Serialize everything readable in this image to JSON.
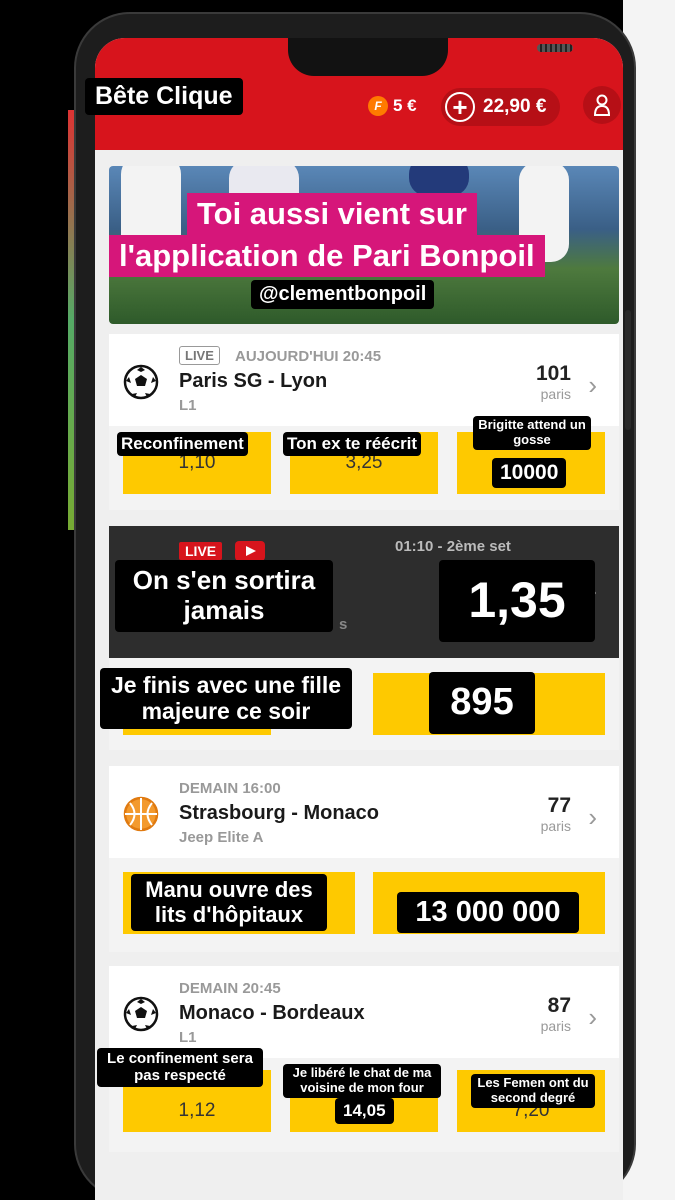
{
  "app": {
    "brand": "Bête Clique",
    "freebet_label": "F",
    "freebet_amount": "5 €",
    "balance": "22,90 €"
  },
  "banner": {
    "line1": "Toi aussi vient sur",
    "line2": "l'application de Pari Bonpoil",
    "handle": "@clementbonpoil"
  },
  "matches": [
    {
      "live_tag": "LIVE",
      "when": "AUJOURD'HUI 20:45",
      "teams": "Paris SG - Lyon",
      "league": "L1",
      "bets_count": "101",
      "bets_label": "paris",
      "odds": [
        {
          "label": "Reconfinement",
          "value": "1,10"
        },
        {
          "label": "Ton ex te réécrit",
          "value": "3,25"
        },
        {
          "label": "Brigitte attend un gosse",
          "value": "10000"
        }
      ]
    },
    {
      "live_tag": "LIVE",
      "when": "01:10 - 2ème set",
      "teams_overlay": "On s'en sortira jamais",
      "teams_suffix": "s",
      "big_odd": "1,35",
      "odds": [
        {
          "label": "Je finis avec une fille majeure ce soir",
          "value": ""
        },
        {
          "label": "",
          "value": "895"
        }
      ]
    },
    {
      "when": "DEMAIN 16:00",
      "teams": "Strasbourg - Monaco",
      "league": "Jeep Elite A",
      "bets_count": "77",
      "bets_label": "paris",
      "odds": [
        {
          "label": "Manu ouvre des lits d'hôpitaux",
          "value": ""
        },
        {
          "label": "",
          "value": "13 000 000"
        }
      ]
    },
    {
      "when": "DEMAIN 20:45",
      "teams": "Monaco - Bordeaux",
      "league": "L1",
      "bets_count": "87",
      "bets_label": "paris",
      "odds": [
        {
          "label": "Le confinement sera pas respecté",
          "value": "1,12"
        },
        {
          "label": "Je libéré le chat de ma voisine de mon four",
          "value": "14,05"
        },
        {
          "label": "Les Femen ont du second degré",
          "value": "7,20"
        }
      ]
    }
  ],
  "colors": {
    "brand_red": "#d7141c",
    "odd_yellow": "#fec900",
    "banner_pink": "#d6167a"
  }
}
